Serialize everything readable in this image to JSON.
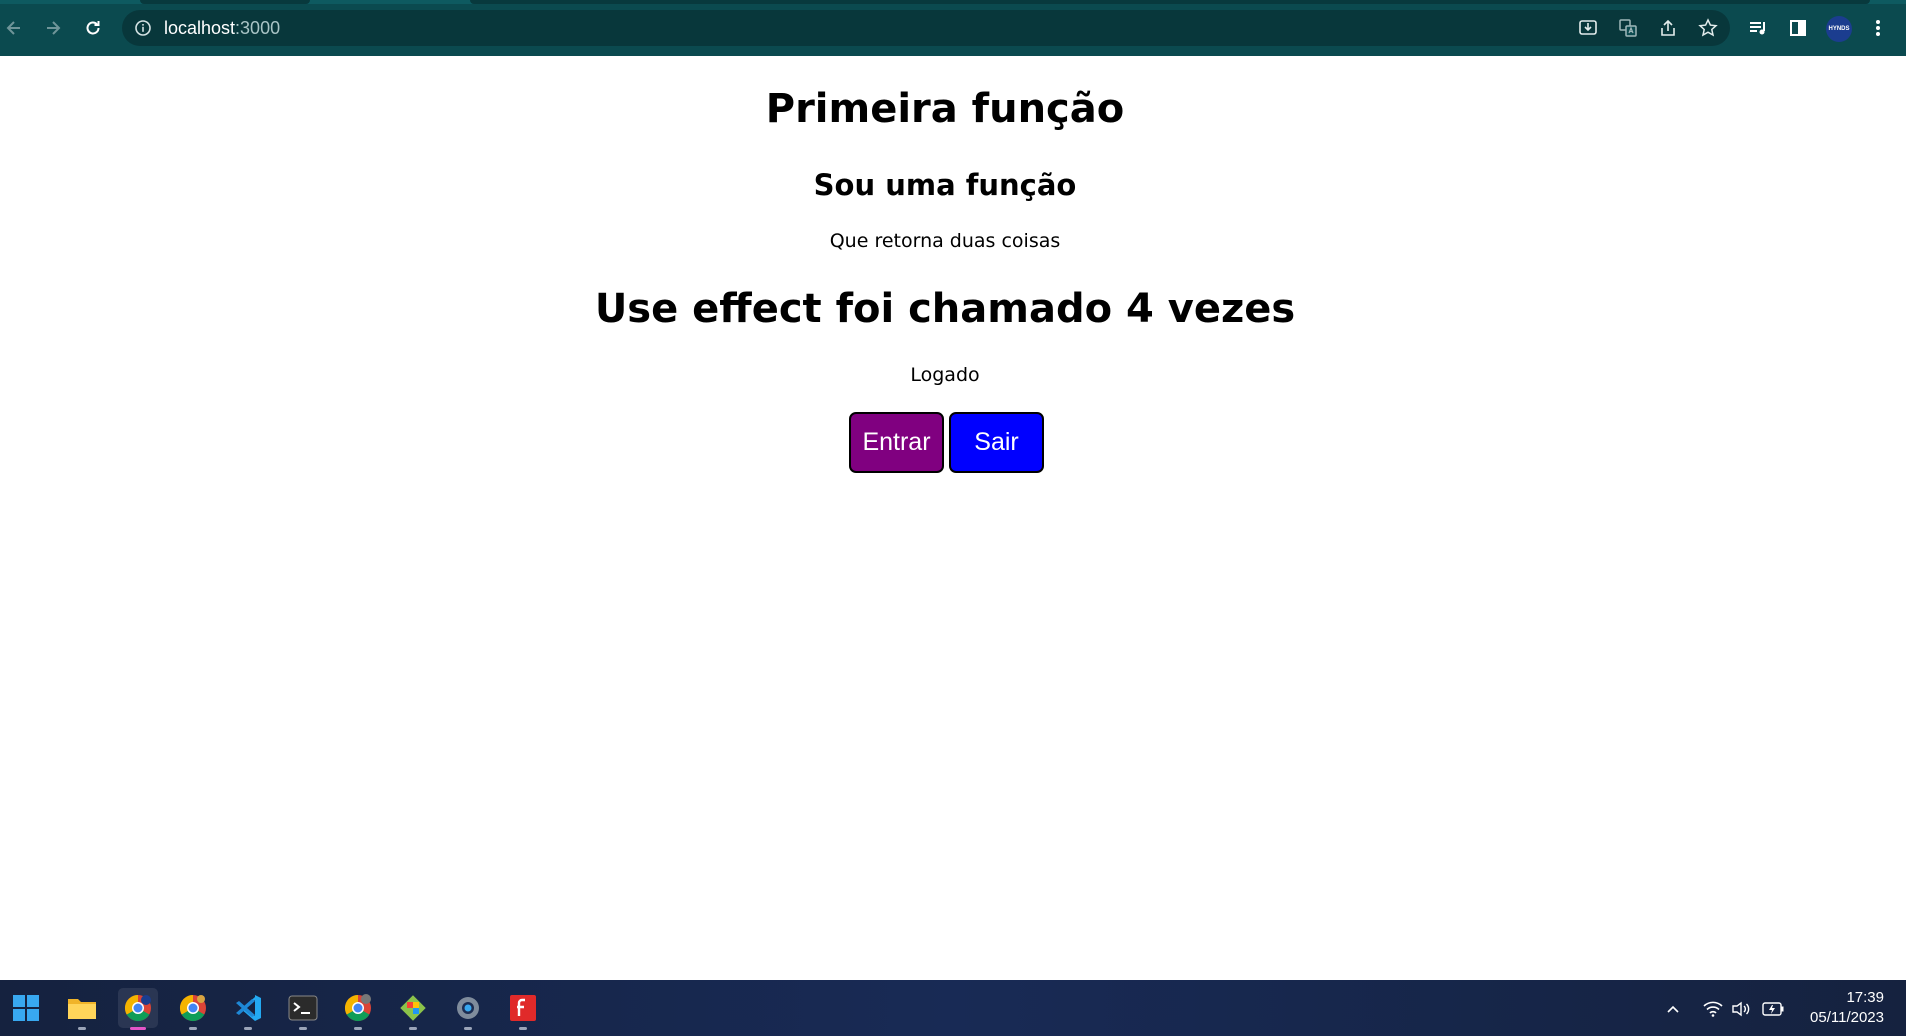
{
  "browser": {
    "url_host": "localhost",
    "url_port": ":3000",
    "profile_label": "HYNDS"
  },
  "page": {
    "title": "Primeira função",
    "subtitle": "Sou uma função",
    "description": "Que retorna duas coisas",
    "effect_message": "Use effect foi chamado 4 vezes",
    "status": "Logado",
    "buttons": {
      "enter_label": "Entrar",
      "exit_label": "Sair"
    },
    "colors": {
      "enter": "#800080",
      "exit": "#0000ff"
    }
  },
  "taskbar": {
    "apps": [
      "windows-start",
      "file-explorer",
      "chrome-profile-hynds",
      "chrome",
      "vs-code",
      "terminal",
      "chrome-profile-2",
      "git-gui",
      "settings",
      "foxit-reader"
    ],
    "time": "17:39",
    "date": "05/11/2023"
  }
}
